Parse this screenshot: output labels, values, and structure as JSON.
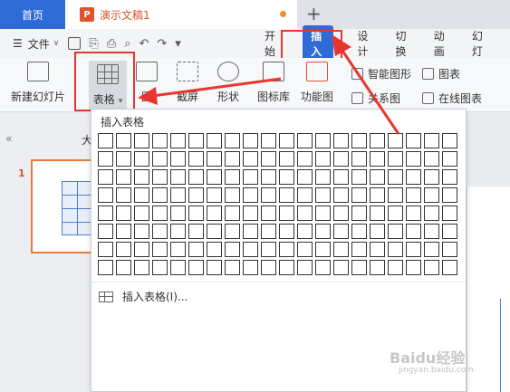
{
  "titlebar": {
    "home_tab": "首页",
    "doc_tab": "演示文稿1",
    "doc_icon_letter": "P",
    "new_tab": "+"
  },
  "menubar": {
    "file": "文件",
    "tabs": [
      "开始",
      "插入",
      "设计",
      "切换",
      "动画",
      "幻灯"
    ]
  },
  "ribbon": {
    "new_slide": "新建幻灯片",
    "table": "表格",
    "picture": "图",
    "screenshot": "截屏",
    "shape": "形状",
    "icon_lib": "图标库",
    "func_chart": "功能图",
    "smart_art": "智能图形",
    "chart": "图表",
    "relation": "关系图",
    "online_chart": "在线图表"
  },
  "leftpanel": {
    "collapse": "«",
    "label": "大",
    "slide_number": "1"
  },
  "dropdown": {
    "title": "插入表格",
    "grid_columns": 20,
    "grid_rows": 8,
    "insert_item": "插入表格(I)..."
  },
  "watermark": {
    "main": "Baidu经验",
    "sub": "jingyan.baidu.com"
  },
  "colors": {
    "accent": "#2f6bd6",
    "annotation": "#e8352f",
    "doc": "#d9532b"
  }
}
